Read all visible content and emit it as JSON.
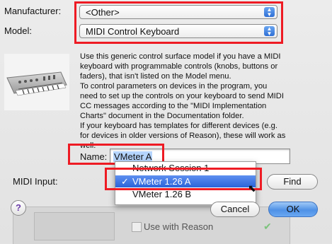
{
  "manufacturer": {
    "label": "Manufacturer:",
    "value": "<Other>"
  },
  "model": {
    "label": "Model:",
    "value": "MIDI Control Keyboard"
  },
  "description": [
    "Use this generic control surface model if you have a MIDI",
    "keyboard with programmable controls (knobs, buttons or",
    "faders), that isn't listed on the Model menu.",
    "To control parameters on devices in the program, you",
    "need to set up the controls on your keyboard to send MIDI",
    "CC messages according to the \"MIDI Implementation",
    "Charts\" document in the Documentation folder.",
    "If your keyboard has templates for different devices (e.g.",
    "for devices in older versions of Reason), these will work as",
    "well."
  ],
  "name_field": {
    "label": "Name:",
    "value": "VMeter A"
  },
  "midi_input": {
    "label": "MIDI Input:",
    "options": [
      "Network Session 1",
      "VMeter 1.26 A",
      "VMeter 1.26 B"
    ],
    "selected": "VMeter 1.26 A",
    "check": "✓"
  },
  "buttons": {
    "find": "Find",
    "cancel": "Cancel",
    "ok": "OK",
    "help": "?"
  },
  "background": {
    "use_with_reason": "Use with Reason"
  },
  "colors": {
    "highlight": "#ee1b24",
    "accent": "#2f6fd6"
  }
}
